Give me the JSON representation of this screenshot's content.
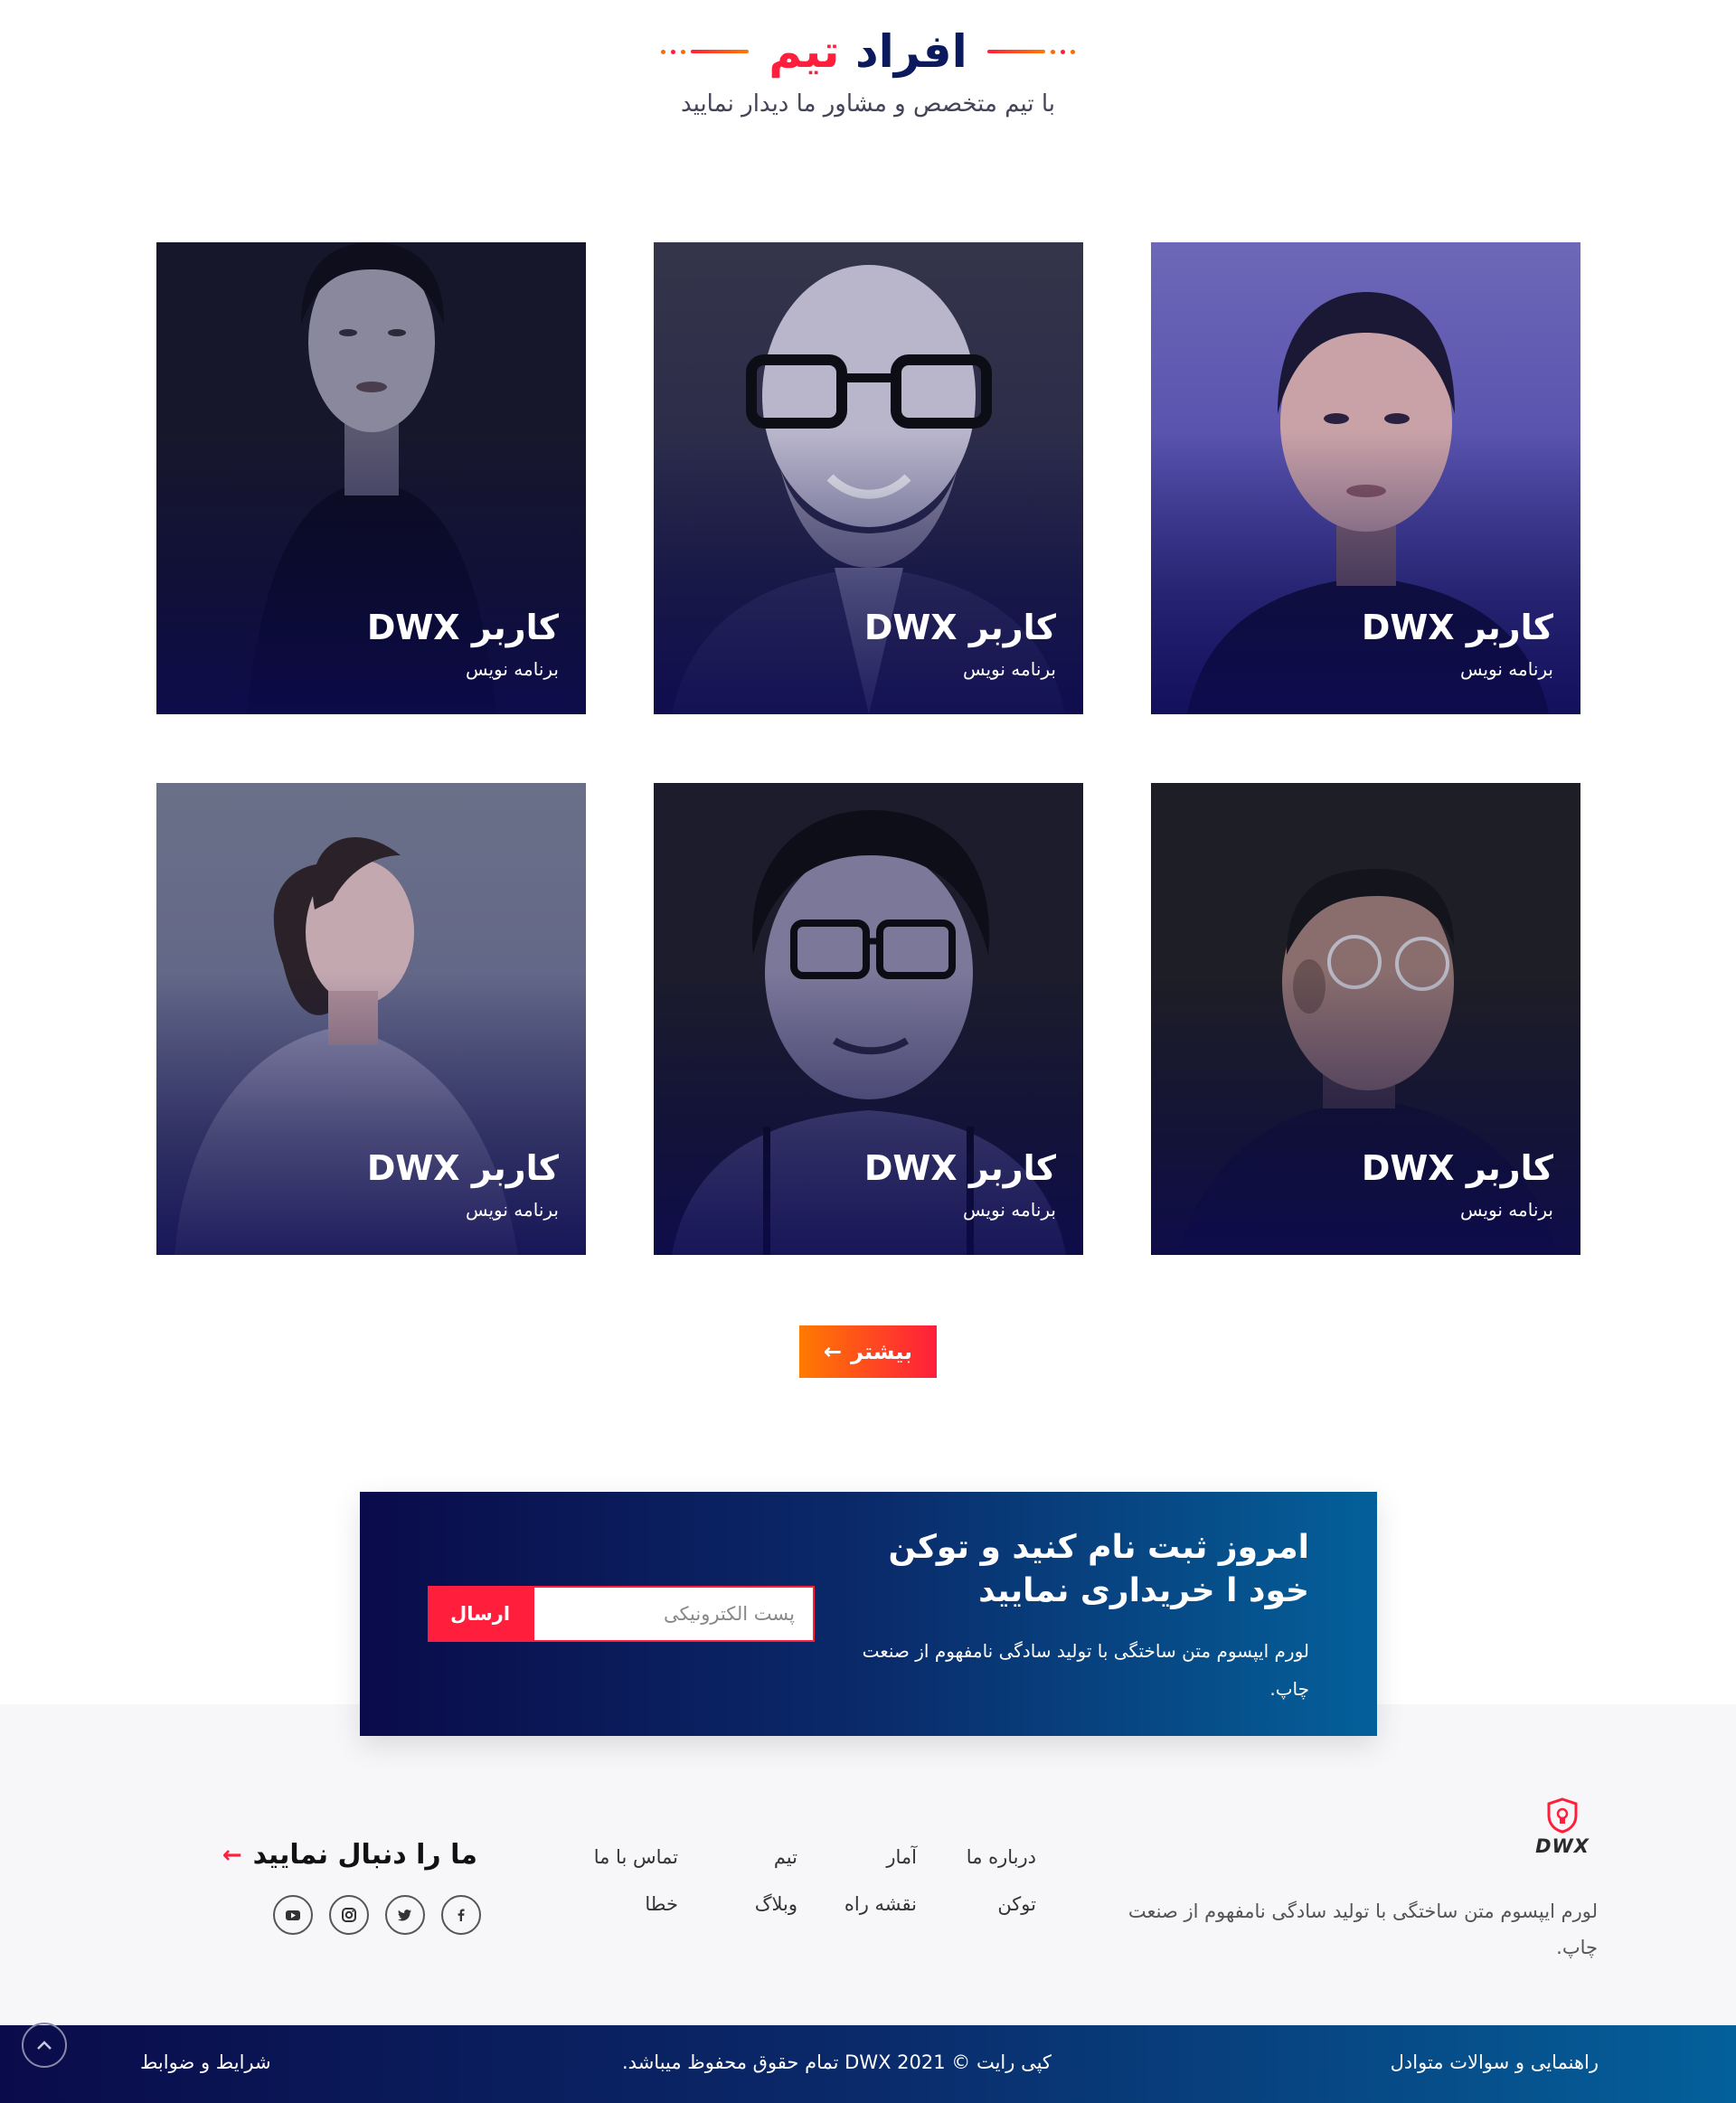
{
  "team_section": {
    "title_part1": "افراد",
    "title_part2": "تیم",
    "subtitle": "با تیم متخصص و مشاور ما دیدار نمایید"
  },
  "members": [
    {
      "name": "کاربر DWX",
      "role": "برنامه نویس"
    },
    {
      "name": "کاربر DWX",
      "role": "برنامه نویس"
    },
    {
      "name": "کاربر DWX",
      "role": "برنامه نویس"
    },
    {
      "name": "کاربر DWX",
      "role": "برنامه نویس"
    },
    {
      "name": "کاربر DWX",
      "role": "برنامه نویس"
    },
    {
      "name": "کاربر DWX",
      "role": "برنامه نویس"
    }
  ],
  "more_button": {
    "label": "بیشتر",
    "arrow": "←"
  },
  "subscribe": {
    "title": "امروز ثبت نام کنید و توکن خود ا خریداری نمایید",
    "text": "لورم ایپسوم متن ساختگی با تولید سادگی نامفهوم از صنعت چاپ.",
    "email_placeholder": "پست الکترونیکی",
    "send_label": "ارسال"
  },
  "footer": {
    "logo_text": "DWX",
    "about": "لورم ایپسوم متن ساختگی با تولید سادگی نامفهوم از صنعت چاپ.",
    "links": [
      "درباره ما",
      "آمار",
      "تیم",
      "تماس با ما",
      "توکن",
      "نقشه راه",
      "وبلاگ",
      "خطا"
    ],
    "follow_title": "ما را دنبال نمایید",
    "follow_arrow": "←",
    "social_icons": [
      "facebook-icon",
      "twitter-icon",
      "instagram-icon",
      "youtube-icon"
    ]
  },
  "bottom_bar": {
    "help": "راهنمایی و سوالات متوادل",
    "copyright": "کپی رایت © DWX 2021 تمام حقوق محفوظ میباشد.",
    "terms": "شرایط و ضوابط"
  },
  "colors": {
    "accent_red": "#ff1e3c",
    "accent_orange": "#ff7a00",
    "navy": "#0a0b4a",
    "blue": "#04609a"
  }
}
